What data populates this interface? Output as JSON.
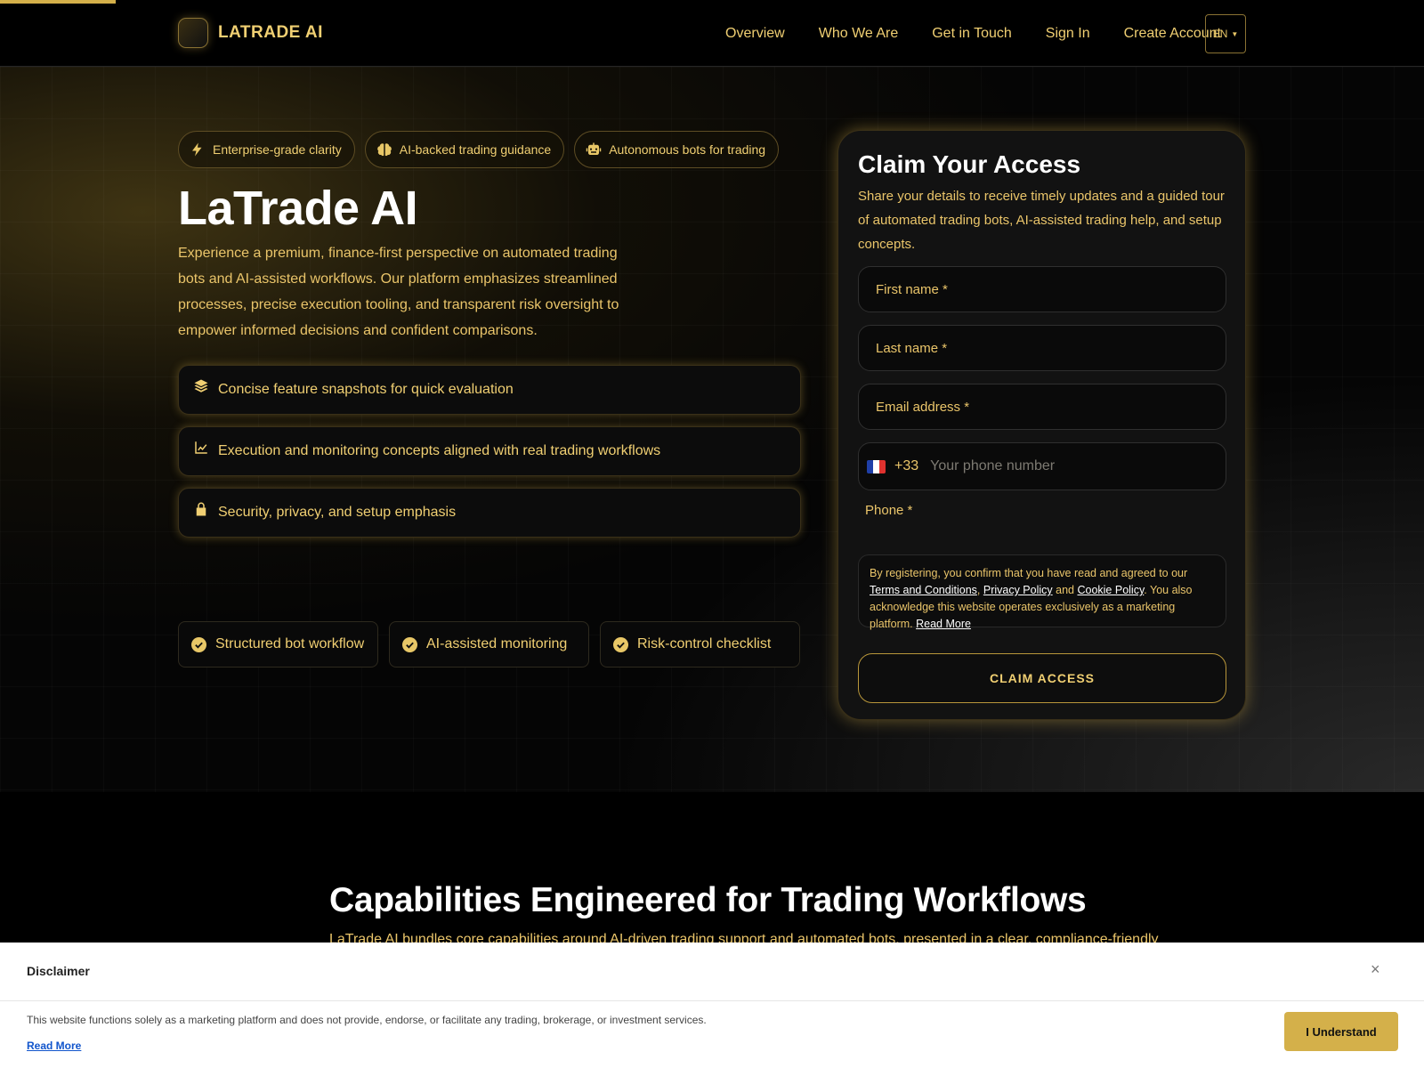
{
  "header": {
    "brand": "LATRADE AI",
    "nav": [
      "Overview",
      "Who We Are",
      "Get in Touch",
      "Sign In",
      "Create Account"
    ],
    "language": "EN"
  },
  "hero": {
    "pills": [
      {
        "label": "Enterprise-grade clarity",
        "icon": "lightning-icon"
      },
      {
        "label": "AI-backed trading guidance",
        "icon": "brain-icon"
      },
      {
        "label": "Autonomous bots for trading",
        "icon": "robot-icon"
      }
    ],
    "title": "LaTrade AI",
    "description": "Experience a premium, finance-first perspective on automated trading bots and AI-assisted workflows. Our platform emphasizes streamlined processes, precise execution tooling, and transparent risk oversight to empower informed decisions and confident comparisons.",
    "features": [
      {
        "label": "Concise feature snapshots for quick evaluation",
        "icon": "layers-icon"
      },
      {
        "label": "Execution and monitoring concepts aligned with real trading workflows",
        "icon": "chart-line-icon"
      },
      {
        "label": "Security, privacy, and setup emphasis",
        "icon": "lock-icon"
      }
    ],
    "checks": [
      "Structured bot workflow",
      "AI-assisted monitoring",
      "Risk-control checklist"
    ]
  },
  "form": {
    "title": "Claim Your Access",
    "subtitle": "Share your details to receive timely updates and a guided tour of automated trading bots, AI-assisted trading help, and setup concepts.",
    "first_name_placeholder": "First name *",
    "last_name_placeholder": "Last name *",
    "email_placeholder": "Email address *",
    "phone_code": "+33",
    "phone_placeholder": "Your phone number",
    "phone_label": "Phone *",
    "consent_prefix": "By registering, you confirm that you have read and agreed to our ",
    "terms_link": "Terms and Conditions",
    "comma": ", ",
    "privacy_link": "Privacy Policy",
    "and": " and ",
    "cookie_link": "Cookie Policy",
    "consent_suffix": ". You also acknowledge this website operates exclusively as a marketing platform. ",
    "read_more": "Read More",
    "submit": "CLAIM ACCESS",
    "colors": {
      "accent": "#f0cf72",
      "flag_blue": "#1f3fa8",
      "flag_white": "#ffffff",
      "flag_red": "#e0322f"
    }
  },
  "capabilities": {
    "title": "Capabilities Engineered for Trading Workflows",
    "description": "LaTrade AI bundles core capabilities around AI-driven trading support and automated bots, presented in a clear, compliance-friendly"
  },
  "disclaimer": {
    "title": "Disclaimer",
    "close": "×",
    "text": "This website functions solely as a marketing platform and does not provide, endorse, or facilitate any trading, brokerage, or investment services.",
    "read_more": "Read More",
    "button": "I Understand"
  }
}
